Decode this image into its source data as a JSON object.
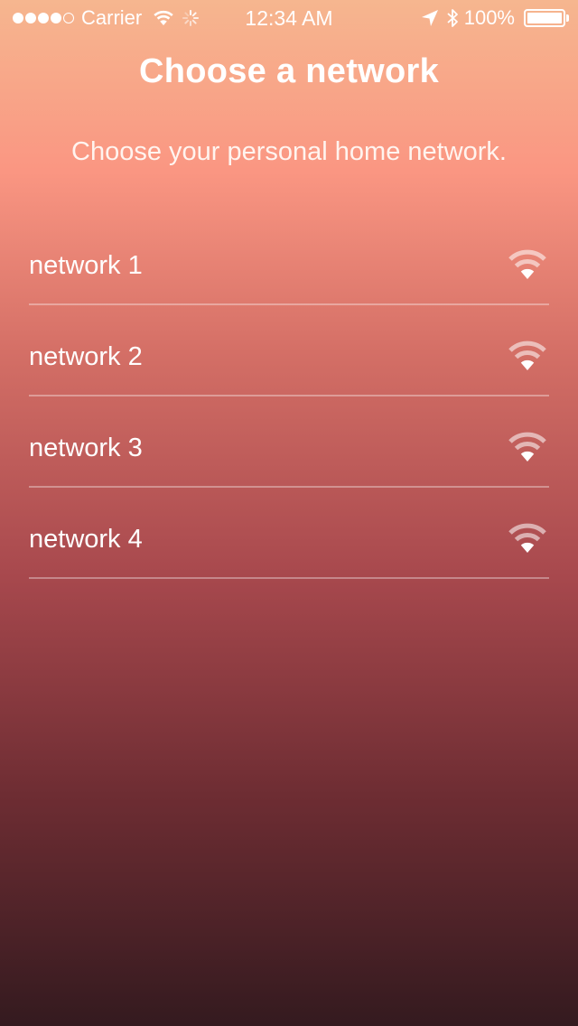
{
  "status_bar": {
    "carrier": "Carrier",
    "time": "12:34 AM",
    "battery": "100%",
    "signal_strength": 4,
    "icons": [
      "signal-dots",
      "wifi-icon",
      "activity-spinner-icon",
      "location-arrow-icon",
      "bluetooth-icon",
      "battery-icon"
    ]
  },
  "header": {
    "title": "Choose a network",
    "subtitle": "Choose your personal home network."
  },
  "networks": [
    {
      "name": "network 1",
      "icon": "wifi-icon"
    },
    {
      "name": "network 2",
      "icon": "wifi-icon"
    },
    {
      "name": "network 3",
      "icon": "wifi-icon"
    },
    {
      "name": "network 4",
      "icon": "wifi-icon"
    }
  ],
  "colors": {
    "gradient_top": "#f6b68f",
    "gradient_bottom": "#341a1f",
    "text": "#ffffff"
  }
}
